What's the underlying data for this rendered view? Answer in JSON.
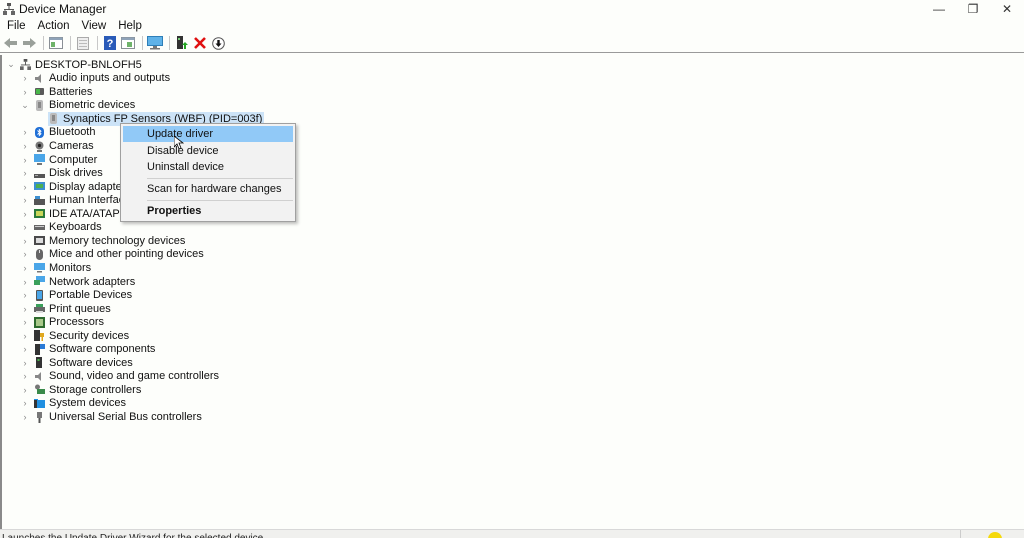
{
  "window": {
    "title": "Device Manager",
    "controls": {
      "minimize": "—",
      "restore": "❐",
      "close": "✕"
    }
  },
  "menubar": {
    "items": [
      "File",
      "Action",
      "View",
      "Help"
    ]
  },
  "toolbar": {
    "buttons": [
      {
        "name": "back",
        "icon": "arrow-left-icon"
      },
      {
        "name": "forward",
        "icon": "arrow-right-icon"
      },
      {
        "name": "show-hide-console-tree",
        "icon": "console-tree-icon"
      },
      {
        "name": "properties",
        "icon": "properties-icon"
      },
      {
        "name": "help",
        "icon": "help-icon",
        "glyph": "?"
      },
      {
        "name": "run",
        "icon": "run-icon"
      },
      {
        "name": "scan-hardware",
        "icon": "monitor-scan-icon"
      },
      {
        "name": "update-driver",
        "icon": "update-driver-icon"
      },
      {
        "name": "uninstall-device",
        "icon": "red-x-icon",
        "glyph": "✕"
      },
      {
        "name": "enable-disable",
        "icon": "down-arrow-circle-icon",
        "glyph": "⬇"
      }
    ]
  },
  "tree": {
    "root": {
      "label": "DESKTOP-BNLOFH5",
      "expanded": true
    },
    "categories": [
      {
        "label": "Audio inputs and outputs",
        "icon": "speaker-icon",
        "expanded": false
      },
      {
        "label": "Batteries",
        "icon": "battery-icon",
        "expanded": false
      },
      {
        "label": "Biometric devices",
        "icon": "biometric-icon",
        "expanded": true,
        "children": [
          {
            "label": "Synaptics FP Sensors (WBF) (PID=003f)",
            "icon": "fingerprint-icon",
            "selected": true
          }
        ]
      },
      {
        "label": "Bluetooth",
        "icon": "bluetooth-icon",
        "expanded": false
      },
      {
        "label": "Cameras",
        "icon": "camera-icon",
        "expanded": false
      },
      {
        "label": "Computer",
        "icon": "computer-icon",
        "expanded": false
      },
      {
        "label": "Disk drives",
        "icon": "disk-drive-icon",
        "expanded": false
      },
      {
        "label": "Display adapters",
        "icon": "display-adapter-icon",
        "expanded": false
      },
      {
        "label": "Human Interface Devices",
        "icon": "hid-icon",
        "expanded": false
      },
      {
        "label": "IDE ATA/ATAPI controllers",
        "icon": "ide-icon",
        "expanded": false
      },
      {
        "label": "Keyboards",
        "icon": "keyboard-icon",
        "expanded": false
      },
      {
        "label": "Memory technology devices",
        "icon": "memory-icon",
        "expanded": false
      },
      {
        "label": "Mice and other pointing devices",
        "icon": "mouse-icon",
        "expanded": false
      },
      {
        "label": "Monitors",
        "icon": "monitor-icon",
        "expanded": false
      },
      {
        "label": "Network adapters",
        "icon": "network-icon",
        "expanded": false
      },
      {
        "label": "Portable Devices",
        "icon": "portable-device-icon",
        "expanded": false
      },
      {
        "label": "Print queues",
        "icon": "printer-icon",
        "expanded": false
      },
      {
        "label": "Processors",
        "icon": "processor-icon",
        "expanded": false
      },
      {
        "label": "Security devices",
        "icon": "security-icon",
        "expanded": false
      },
      {
        "label": "Software components",
        "icon": "software-component-icon",
        "expanded": false
      },
      {
        "label": "Software devices",
        "icon": "software-device-icon",
        "expanded": false
      },
      {
        "label": "Sound, video and game controllers",
        "icon": "sound-icon",
        "expanded": false
      },
      {
        "label": "Storage controllers",
        "icon": "storage-icon",
        "expanded": false
      },
      {
        "label": "System devices",
        "icon": "system-folder-icon",
        "expanded": false
      },
      {
        "label": "Universal Serial Bus controllers",
        "icon": "usb-icon",
        "expanded": false
      }
    ]
  },
  "context_menu": {
    "items": [
      {
        "label": "Update driver",
        "highlighted": true
      },
      {
        "label": "Disable device"
      },
      {
        "label": "Uninstall device"
      },
      {
        "separator": true
      },
      {
        "label": "Scan for hardware changes"
      },
      {
        "separator": true
      },
      {
        "label": "Properties",
        "bold": true
      }
    ]
  },
  "statusbar": {
    "text": "Launches the Update Driver Wizard for the selected device."
  },
  "colors": {
    "selection": "#cce3f7",
    "menu_highlight": "#91c9f7",
    "background": "#fdfefb",
    "uninstall_red": "#e01010",
    "help_blue": "#2a5bb8"
  }
}
